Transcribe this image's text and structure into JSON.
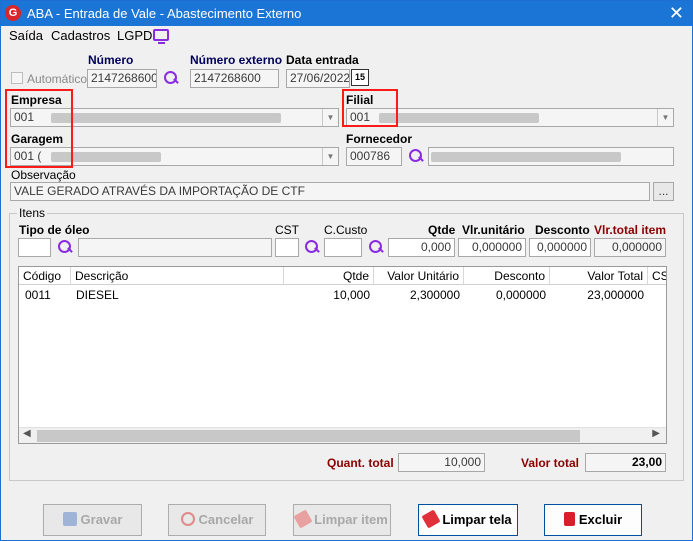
{
  "window": {
    "title": "ABA - Entrada de Vale - Abastecimento Externo",
    "logo": "G"
  },
  "menu": {
    "items": [
      "Saída",
      "Cadastros",
      "LGPD"
    ]
  },
  "header": {
    "automatico_label": "Automático",
    "numero_label": "Número",
    "numero_value": "2147268600",
    "numero_externo_label": "Número externo",
    "numero_externo_value": "2147268600",
    "data_entrada_label": "Data entrada",
    "data_entrada_value": "27/06/2022",
    "calendar_text": "15"
  },
  "empresa": {
    "label": "Empresa",
    "value": "001"
  },
  "filial": {
    "label": "Filial",
    "value": "001"
  },
  "garagem": {
    "label": "Garagem",
    "value": "001 ("
  },
  "fornecedor": {
    "label": "Fornecedor",
    "value": "000786"
  },
  "observacao": {
    "label": "Observação",
    "value": "VALE GERADO ATRAVÉS DA IMPORTAÇÃO DE CTF",
    "more_button": "..."
  },
  "itens": {
    "group_label": "Itens",
    "tipo_oleo_label": "Tipo de óleo",
    "cst_label": "CST",
    "ccusto_label": "C.Custo",
    "qtde_label": "Qtde",
    "qtde_value": "0,000",
    "vlr_unitario_label": "Vlr.unitário",
    "vlr_unitario_value": "0,000000",
    "desconto_label": "Desconto",
    "desconto_value": "0,000000",
    "vlr_total_label": "Vlr.total item",
    "vlr_total_value": "0,000000"
  },
  "grid": {
    "columns": [
      "Código",
      "Descrição",
      "Qtde",
      "Valor Unitário",
      "Desconto",
      "Valor Total",
      "CS"
    ],
    "rows": [
      {
        "codigo": "0011",
        "descricao": "DIESEL",
        "qtde": "10,000",
        "valor_unitario": "2,300000",
        "desconto": "0,000000",
        "valor_total": "23,000000"
      }
    ]
  },
  "totals": {
    "quant_label": "Quant. total",
    "quant_value": "10,000",
    "valor_label": "Valor total",
    "valor_value": "23,00"
  },
  "buttons": {
    "gravar": "Gravar",
    "cancelar": "Cancelar",
    "limpar_item": "Limpar item",
    "limpar_tela": "Limpar tela",
    "excluir": "Excluir"
  },
  "colors": {
    "title_bar": "#1a75d6",
    "highlight": "#ff1a1a",
    "accent": "#8a2be2",
    "label_dark_red": "#8b0000"
  }
}
